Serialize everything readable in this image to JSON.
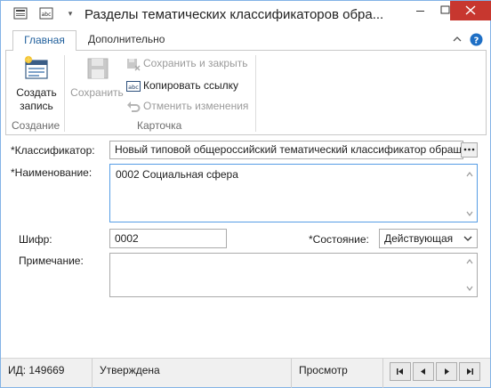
{
  "window": {
    "title": "Разделы тематических классификаторов обра..."
  },
  "ribbon": {
    "tabs": [
      {
        "label": "Главная",
        "active": true
      },
      {
        "label": "Дополнительно",
        "active": false
      }
    ],
    "create_group": {
      "button_label_line1": "Создать",
      "button_label_line2": "запись",
      "group_label": "Создание"
    },
    "card_group": {
      "save_label": "Сохранить",
      "save_close_label": "Сохранить и закрыть",
      "copy_link_label": "Копировать ссылку",
      "undo_label": "Отменить изменения",
      "group_label": "Карточка"
    }
  },
  "form": {
    "classifier": {
      "label": "*Классификатор:",
      "value": "Новый типовой общероссийский тематический классификатор обращ"
    },
    "name": {
      "label": "*Наименование:",
      "value": "0002 Социальная сфера"
    },
    "code": {
      "label": "Шифр:",
      "value": "0002"
    },
    "state": {
      "label": "*Состояние:",
      "value": "Действующая"
    },
    "note": {
      "label": "Примечание:",
      "value": ""
    }
  },
  "statusbar": {
    "id_text": "ИД: 149669",
    "status_text": "Утверждена",
    "mode_text": "Просмотр"
  },
  "colors": {
    "accent": "#1e5e9b",
    "close_button": "#c7372f",
    "window_border": "#83b3e6"
  }
}
